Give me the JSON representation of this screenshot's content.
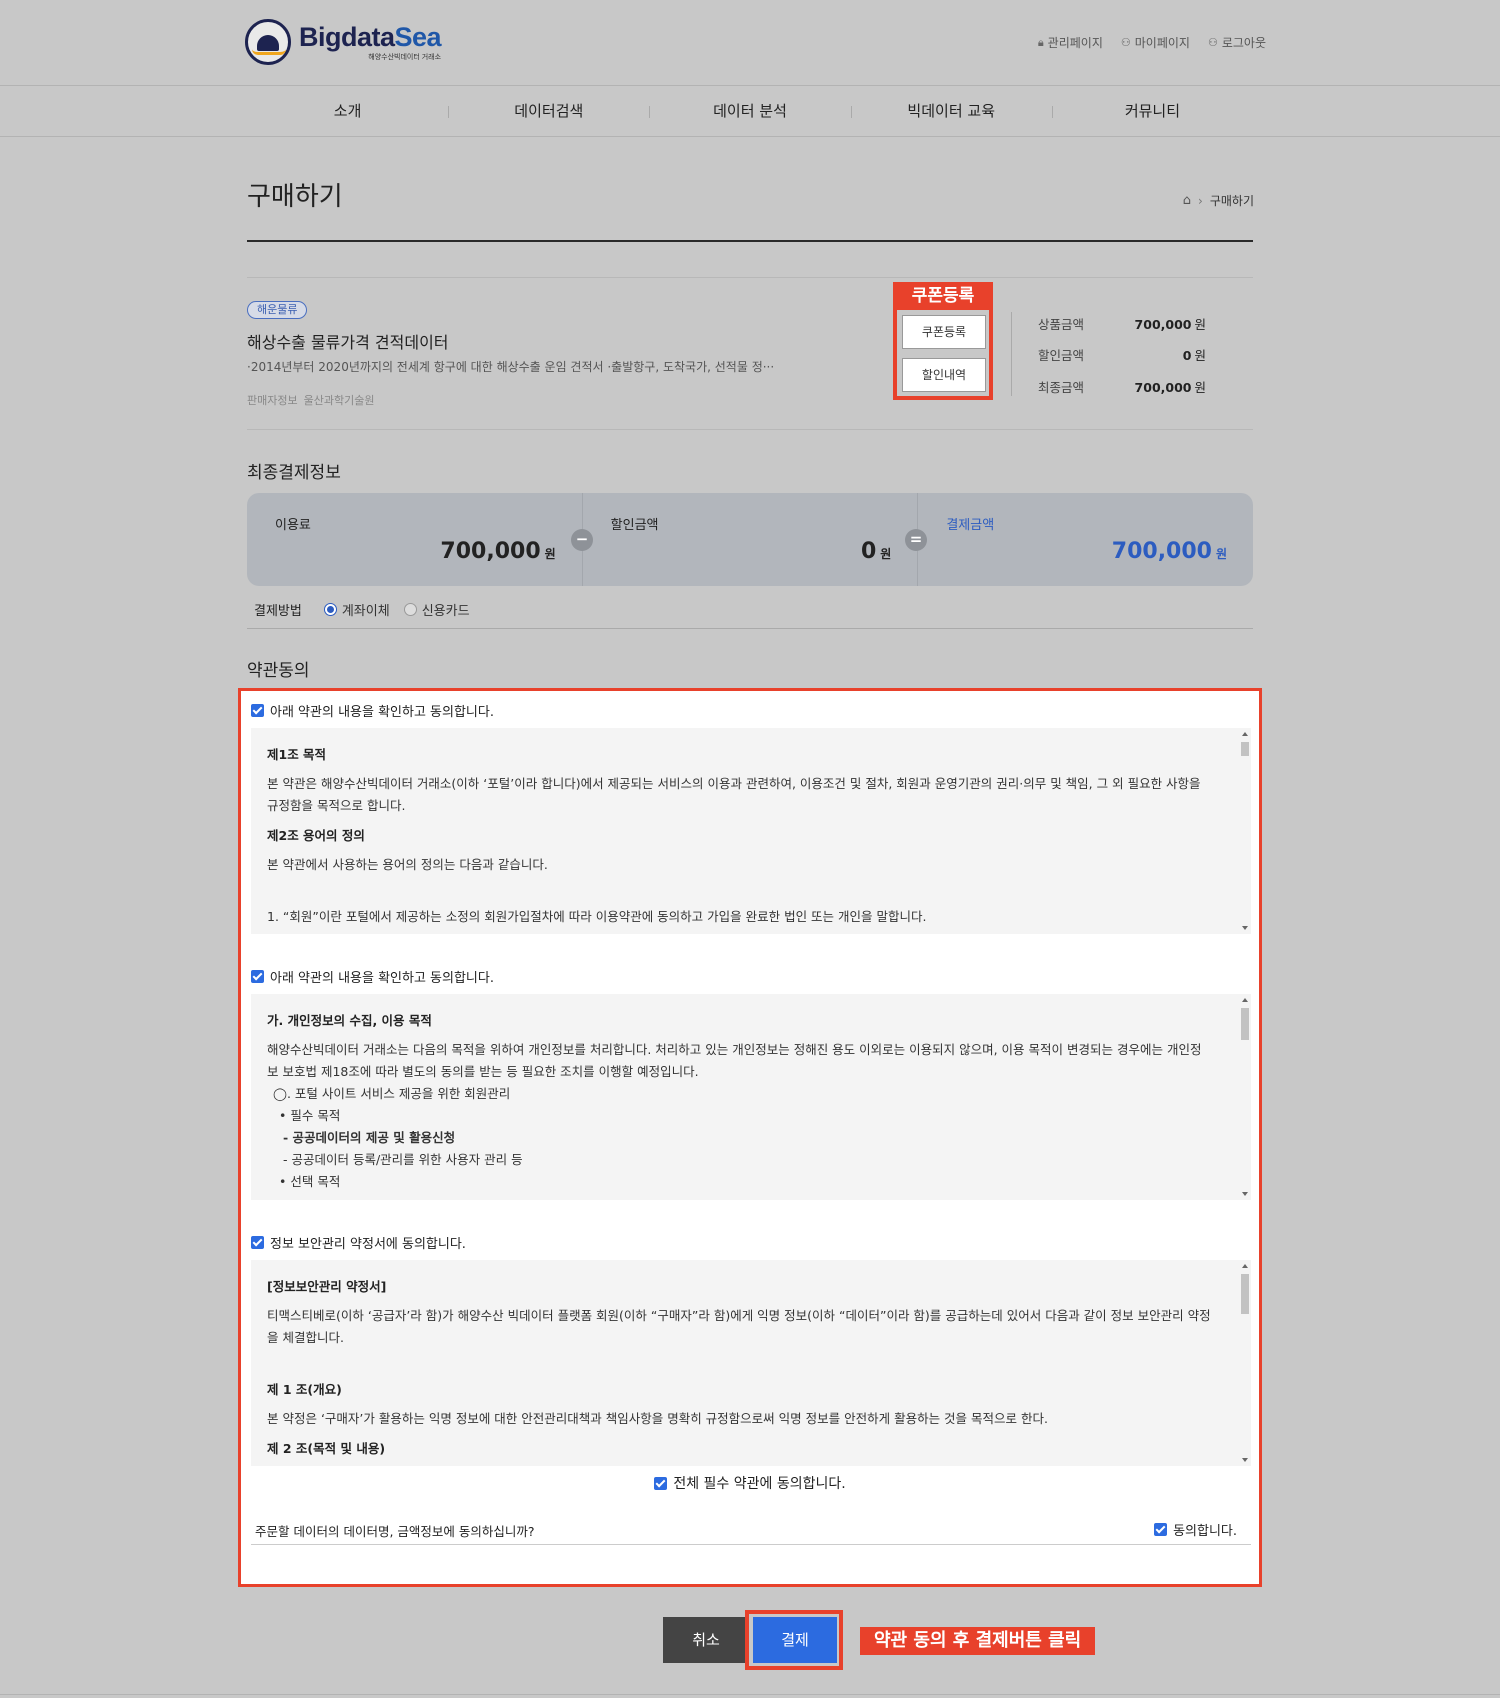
{
  "header": {
    "logo_main": "Bigdata",
    "logo_accent": "Sea",
    "logo_sub": "해양수산빅데이터 거래소",
    "util_links": [
      "관리페이지",
      "마이페이지",
      "로그아웃"
    ]
  },
  "nav": [
    "소개",
    "데이터검색",
    "데이터 분석",
    "빅데이터 교육",
    "커뮤니티"
  ],
  "page": {
    "title": "구매하기",
    "breadcrumb": "구매하기"
  },
  "product": {
    "tag": "해운물류",
    "name": "해상수출 물류가격 견적데이터",
    "desc": "·2014년부터 2020년까지의 전세계 항구에 대한 해상수출 운임 견적서 ·출발항구, 도착국가, 선적물 정···",
    "seller_label": "판매자정보",
    "seller_name": "울산과학기술원"
  },
  "coupon": {
    "annotation": "쿠폰등록",
    "register_label": "쿠폰등록",
    "history_label": "할인내역"
  },
  "price_summary": [
    {
      "label": "상품금액",
      "value": "700,000",
      "unit": "원"
    },
    {
      "label": "할인금액",
      "value": "0",
      "unit": "원"
    },
    {
      "label": "최종금액",
      "value": "700,000",
      "unit": "원"
    }
  ],
  "final_payment": {
    "title": "최종결제정보",
    "fee_label": "이용료",
    "fee_value": "700,000",
    "discount_label": "할인금액",
    "discount_value": "0",
    "total_label": "결제금액",
    "total_value": "700,000",
    "unit": "원",
    "minus": "−",
    "equals": "="
  },
  "payment_method": {
    "label": "결제방법",
    "options": [
      "계좌이체",
      "신용카드"
    ],
    "selected": "계좌이체"
  },
  "terms": {
    "title": "약관동의",
    "agree1": "아래 약관의 내용을 확인하고 동의합니다.",
    "box1": {
      "h1": "제1조 목적",
      "p1": "본 약관은 해양수산빅데이터 거래소(이하 ‘포털’이라 합니다)에서 제공되는 서비스의 이용과 관련하여, 이용조건 및 절차, 회원과 운영기관의 권리·의무 및 책임, 그 외 필요한 사항을 규정함을 목적으로 합니다.",
      "h2": "제2조 용어의 정의",
      "p2": "본 약관에서 사용하는 용어의 정의는 다음과 같습니다.",
      "p3": "1. “회원”이란 포털에서 제공하는 소정의 회원가입절차에 따라 이용약관에 동의하고 가입을 완료한 법인 또는 개인을 말합니다."
    },
    "agree2": "아래 약관의 내용을 확인하고 동의합니다.",
    "box2": {
      "h1": "가. 개인정보의 수집, 이용 목적",
      "p1": "해양수산빅데이터 거래소는 다음의 목적을 위하여 개인정보를 처리합니다. 처리하고 있는 개인정보는 정해진 용도 이외로는 이용되지 않으며, 이용 목적이 변경되는 경우에는 개인정보 보호법 제18조에 따라 별도의 동의를 받는 등 필요한 조치를 이행할 예정입니다.",
      "l1": "◯. 포털 사이트 서비스 제공을 위한 회원관리",
      "l2": "• 필수 목적",
      "l3": "- 공공데이터의 제공 및 활용신청",
      "l4": "- 공공데이터 등록/관리를 위한 사용자 관리 등",
      "l5": "• 선택 목적"
    },
    "agree3": "정보 보안관리 약정서에 동의합니다.",
    "box3": {
      "h1": "[정보보안관리 약정서]",
      "p1": "티맥스티베로(이하 ‘공급자’라 함)가 해양수산 빅데이터 플랫폼 회원(이하 “구매자”라 함)에게 익명 정보(이하 “데이터”이라 함)를 공급하는데 있어서 다음과 같이 정보 보안관리 약정을 체결합니다.",
      "h2": "제 1 조(개요)",
      "p2": "본 약정은 ‘구매자’가 활용하는 익명 정보에 대한 안전관리대책과 책임사항을 명확히 규정함으로써 익명 정보를 안전하게 활용하는 것을 목적으로 한다.",
      "h3": "제 2 조(목적 및 내용)"
    },
    "all_agree": "전체 필수 약관에 동의합니다.",
    "order_question": "주문할 데이터의 데이터명, 금액정보에 동의하십니까?",
    "order_agree": "동의합니다."
  },
  "actions": {
    "cancel": "취소",
    "pay": "결제",
    "note": "약관 동의 후 결제버튼 클릭"
  },
  "colors": {
    "accent_blue": "#2c6be0",
    "annotation_red": "#e8412b"
  }
}
